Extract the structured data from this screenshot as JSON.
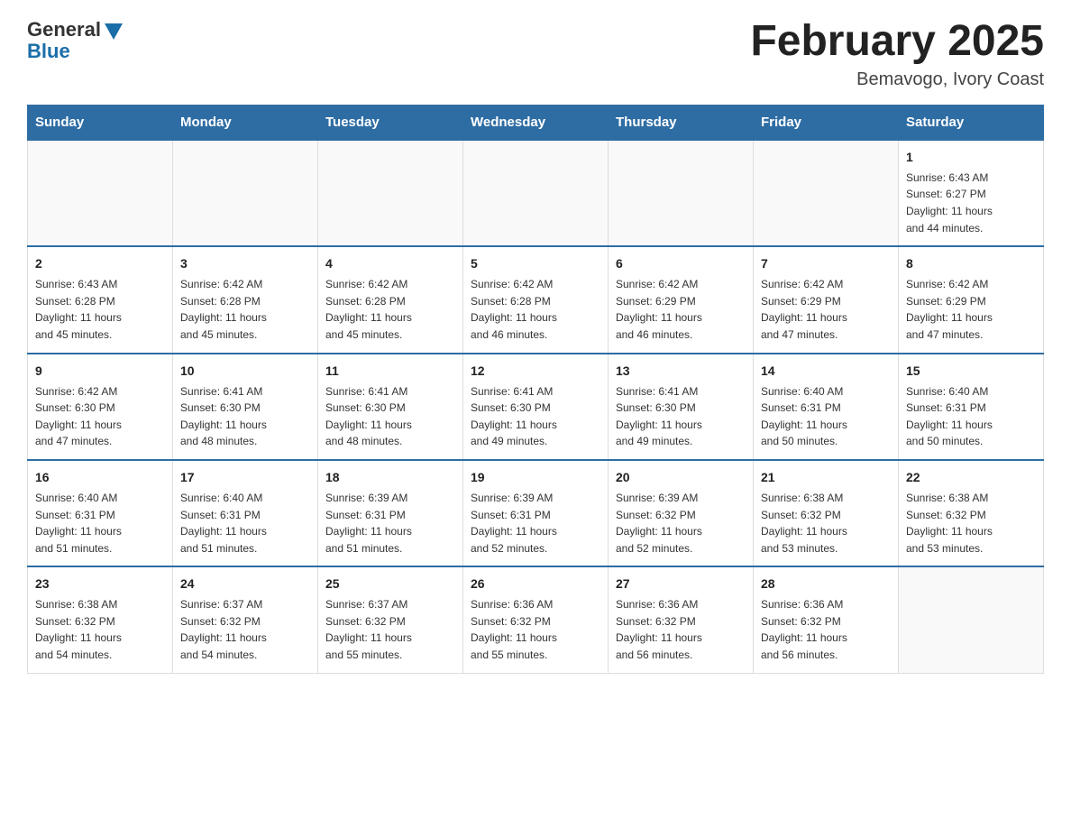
{
  "header": {
    "logo_general": "General",
    "logo_blue": "Blue",
    "month_title": "February 2025",
    "location": "Bemavogo, Ivory Coast"
  },
  "weekdays": [
    "Sunday",
    "Monday",
    "Tuesday",
    "Wednesday",
    "Thursday",
    "Friday",
    "Saturday"
  ],
  "weeks": [
    [
      {
        "day": "",
        "info": ""
      },
      {
        "day": "",
        "info": ""
      },
      {
        "day": "",
        "info": ""
      },
      {
        "day": "",
        "info": ""
      },
      {
        "day": "",
        "info": ""
      },
      {
        "day": "",
        "info": ""
      },
      {
        "day": "1",
        "info": "Sunrise: 6:43 AM\nSunset: 6:27 PM\nDaylight: 11 hours\nand 44 minutes."
      }
    ],
    [
      {
        "day": "2",
        "info": "Sunrise: 6:43 AM\nSunset: 6:28 PM\nDaylight: 11 hours\nand 45 minutes."
      },
      {
        "day": "3",
        "info": "Sunrise: 6:42 AM\nSunset: 6:28 PM\nDaylight: 11 hours\nand 45 minutes."
      },
      {
        "day": "4",
        "info": "Sunrise: 6:42 AM\nSunset: 6:28 PM\nDaylight: 11 hours\nand 45 minutes."
      },
      {
        "day": "5",
        "info": "Sunrise: 6:42 AM\nSunset: 6:28 PM\nDaylight: 11 hours\nand 46 minutes."
      },
      {
        "day": "6",
        "info": "Sunrise: 6:42 AM\nSunset: 6:29 PM\nDaylight: 11 hours\nand 46 minutes."
      },
      {
        "day": "7",
        "info": "Sunrise: 6:42 AM\nSunset: 6:29 PM\nDaylight: 11 hours\nand 47 minutes."
      },
      {
        "day": "8",
        "info": "Sunrise: 6:42 AM\nSunset: 6:29 PM\nDaylight: 11 hours\nand 47 minutes."
      }
    ],
    [
      {
        "day": "9",
        "info": "Sunrise: 6:42 AM\nSunset: 6:30 PM\nDaylight: 11 hours\nand 47 minutes."
      },
      {
        "day": "10",
        "info": "Sunrise: 6:41 AM\nSunset: 6:30 PM\nDaylight: 11 hours\nand 48 minutes."
      },
      {
        "day": "11",
        "info": "Sunrise: 6:41 AM\nSunset: 6:30 PM\nDaylight: 11 hours\nand 48 minutes."
      },
      {
        "day": "12",
        "info": "Sunrise: 6:41 AM\nSunset: 6:30 PM\nDaylight: 11 hours\nand 49 minutes."
      },
      {
        "day": "13",
        "info": "Sunrise: 6:41 AM\nSunset: 6:30 PM\nDaylight: 11 hours\nand 49 minutes."
      },
      {
        "day": "14",
        "info": "Sunrise: 6:40 AM\nSunset: 6:31 PM\nDaylight: 11 hours\nand 50 minutes."
      },
      {
        "day": "15",
        "info": "Sunrise: 6:40 AM\nSunset: 6:31 PM\nDaylight: 11 hours\nand 50 minutes."
      }
    ],
    [
      {
        "day": "16",
        "info": "Sunrise: 6:40 AM\nSunset: 6:31 PM\nDaylight: 11 hours\nand 51 minutes."
      },
      {
        "day": "17",
        "info": "Sunrise: 6:40 AM\nSunset: 6:31 PM\nDaylight: 11 hours\nand 51 minutes."
      },
      {
        "day": "18",
        "info": "Sunrise: 6:39 AM\nSunset: 6:31 PM\nDaylight: 11 hours\nand 51 minutes."
      },
      {
        "day": "19",
        "info": "Sunrise: 6:39 AM\nSunset: 6:31 PM\nDaylight: 11 hours\nand 52 minutes."
      },
      {
        "day": "20",
        "info": "Sunrise: 6:39 AM\nSunset: 6:32 PM\nDaylight: 11 hours\nand 52 minutes."
      },
      {
        "day": "21",
        "info": "Sunrise: 6:38 AM\nSunset: 6:32 PM\nDaylight: 11 hours\nand 53 minutes."
      },
      {
        "day": "22",
        "info": "Sunrise: 6:38 AM\nSunset: 6:32 PM\nDaylight: 11 hours\nand 53 minutes."
      }
    ],
    [
      {
        "day": "23",
        "info": "Sunrise: 6:38 AM\nSunset: 6:32 PM\nDaylight: 11 hours\nand 54 minutes."
      },
      {
        "day": "24",
        "info": "Sunrise: 6:37 AM\nSunset: 6:32 PM\nDaylight: 11 hours\nand 54 minutes."
      },
      {
        "day": "25",
        "info": "Sunrise: 6:37 AM\nSunset: 6:32 PM\nDaylight: 11 hours\nand 55 minutes."
      },
      {
        "day": "26",
        "info": "Sunrise: 6:36 AM\nSunset: 6:32 PM\nDaylight: 11 hours\nand 55 minutes."
      },
      {
        "day": "27",
        "info": "Sunrise: 6:36 AM\nSunset: 6:32 PM\nDaylight: 11 hours\nand 56 minutes."
      },
      {
        "day": "28",
        "info": "Sunrise: 6:36 AM\nSunset: 6:32 PM\nDaylight: 11 hours\nand 56 minutes."
      },
      {
        "day": "",
        "info": ""
      }
    ]
  ]
}
